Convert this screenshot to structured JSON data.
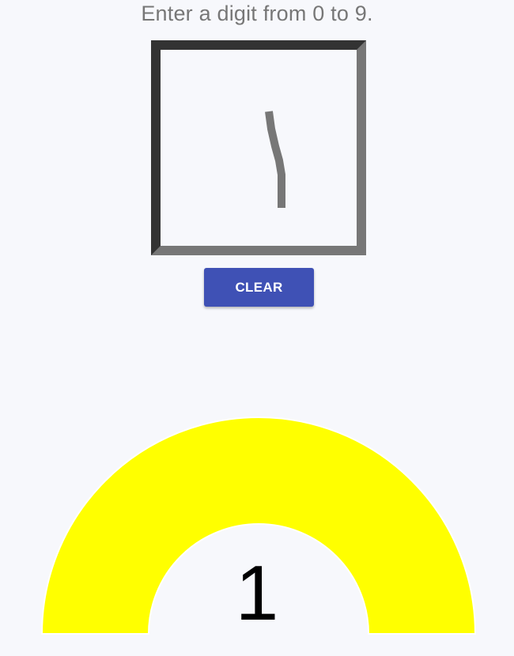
{
  "instruction": "Enter a digit from 0 to 9.",
  "canvas": {
    "stroke_color": "#777777",
    "background": "#f7f8fc"
  },
  "clear_button": {
    "label": "CLEAR",
    "color": "#3f51b5"
  },
  "prediction": {
    "digit": "1",
    "gauge_color": "#ffff00"
  }
}
